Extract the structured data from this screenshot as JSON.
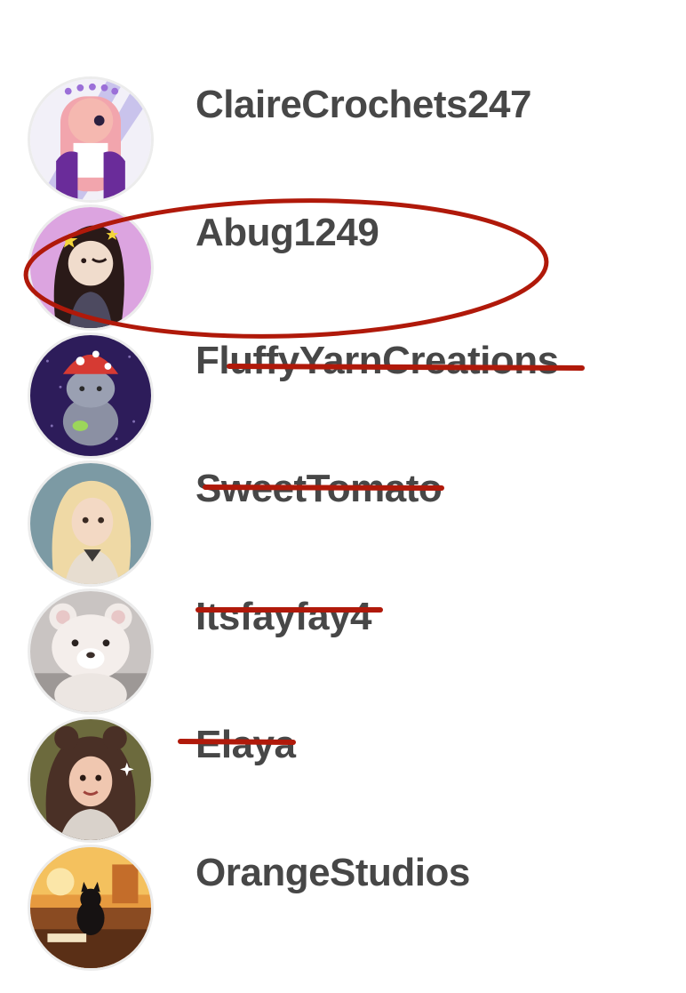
{
  "users": [
    {
      "name": "ClaireCrochets247",
      "avatar_icon": "girl-pink-hair-avatar-icon"
    },
    {
      "name": "Abug1249",
      "avatar_icon": "girl-dark-hair-pink-bg-avatar-icon"
    },
    {
      "name": "FluffyYarnCreations",
      "avatar_icon": "cat-mushroom-hat-avatar-icon"
    },
    {
      "name": "SweetTomato",
      "avatar_icon": "blonde-girl-avatar-icon"
    },
    {
      "name": "Itsfayfay4",
      "avatar_icon": "teddy-bear-avatar-icon"
    },
    {
      "name": "Elaya",
      "avatar_icon": "curly-hair-girl-avatar-icon"
    },
    {
      "name": "OrangeStudios",
      "avatar_icon": "black-cat-sunset-avatar-icon"
    }
  ],
  "annotations": {
    "circled": "Abug1249",
    "crossed_out": [
      "FluffyYarnCreations",
      "SweetTomato",
      "Itsfayfay4",
      "Elaya"
    ],
    "mark_color": "#b0190a"
  },
  "colors": {
    "text": "#474747",
    "background": "#ffffff"
  }
}
